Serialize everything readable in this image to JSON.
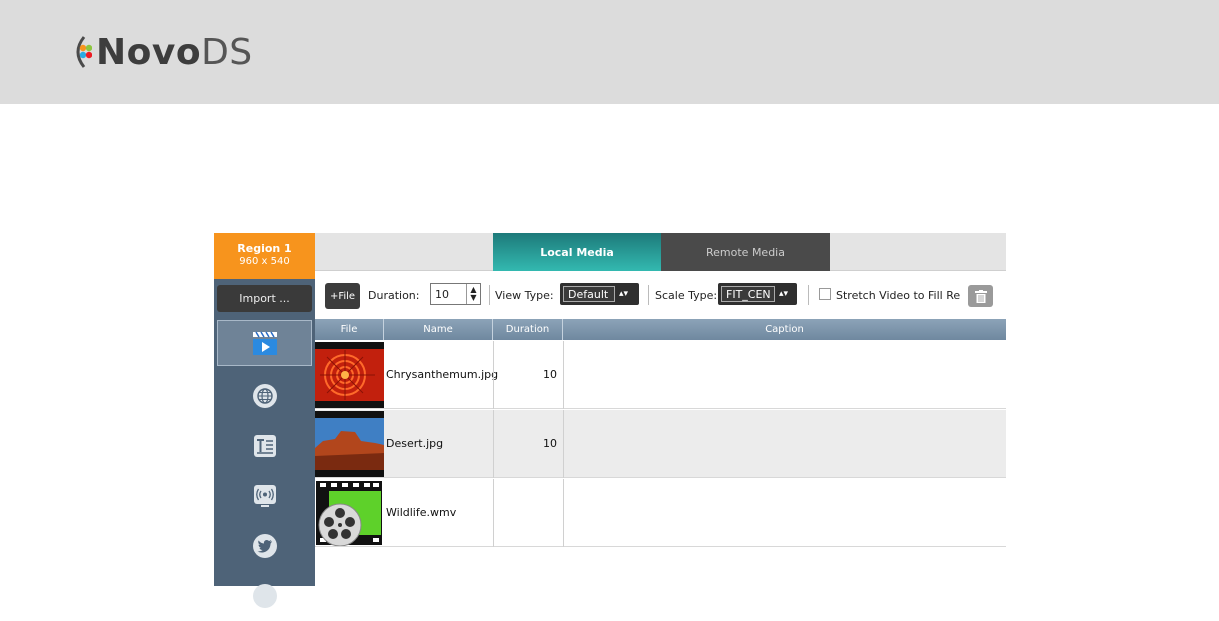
{
  "brand": {
    "logo_bold": "Novo",
    "logo_light": "DS"
  },
  "region": {
    "name": "Region 1",
    "size": "960 x 540"
  },
  "sidebar": {
    "import_label": "Import ..."
  },
  "tabs": {
    "local": "Local Media",
    "remote": "Remote Media"
  },
  "toolbar": {
    "add_file_label": "+File",
    "duration_label": "Duration:",
    "duration_value": "10",
    "view_type_label": "View Type:",
    "view_type_value": "Default",
    "scale_type_label": "Scale Type:",
    "scale_type_value": "FIT_CEN",
    "stretch_label": "Stretch Video to Fill Re"
  },
  "table": {
    "headers": [
      "File",
      "Name",
      "Duration",
      "Caption"
    ],
    "rows": [
      {
        "name": "Chrysanthemum.jpg",
        "duration": "10",
        "caption": ""
      },
      {
        "name": "Desert.jpg",
        "duration": "10",
        "caption": ""
      },
      {
        "name": "Wildlife.wmv",
        "duration": "",
        "caption": ""
      }
    ]
  },
  "colors": {
    "accent": "#f7941d",
    "tab_active": "#33b9b0",
    "sidebar": "#4e6378"
  }
}
